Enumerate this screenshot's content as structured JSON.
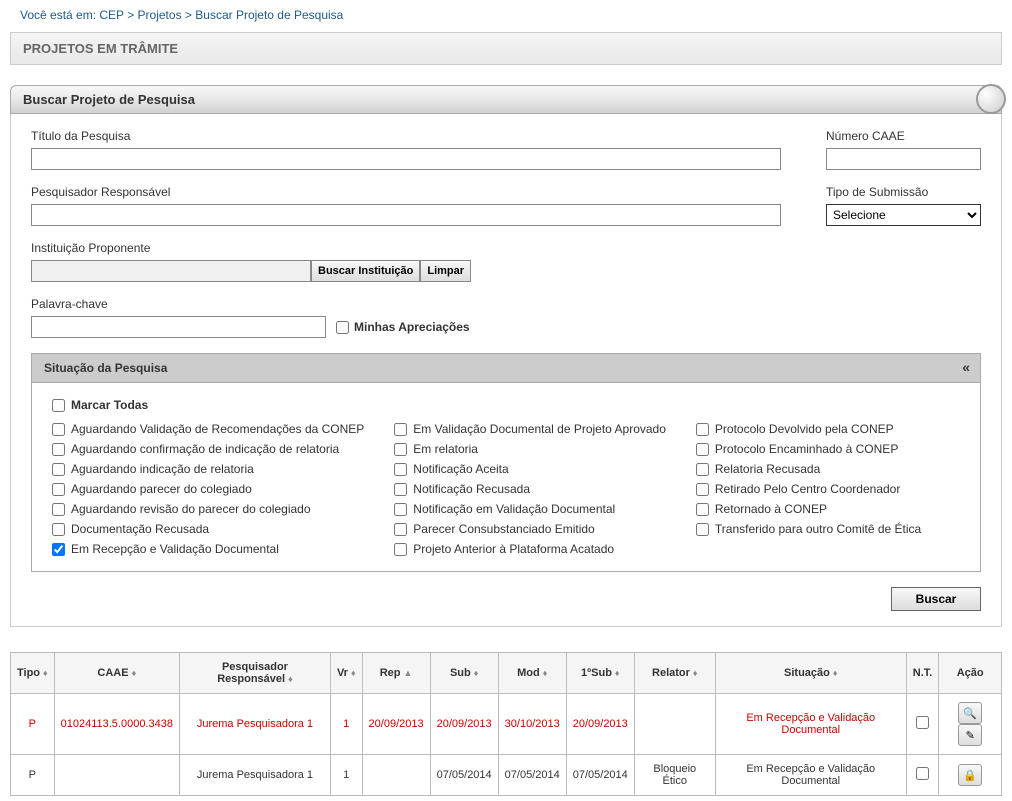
{
  "breadcrumb": {
    "prefix": "Você está em: ",
    "parts": [
      "CEP",
      "Projetos",
      "Buscar Projeto de Pesquisa"
    ]
  },
  "headers": {
    "section": "PROJETOS EM TRÂMITE",
    "search": "Buscar Projeto de Pesquisa",
    "situacao": "Situação da Pesquisa"
  },
  "labels": {
    "titulo": "Título da Pesquisa",
    "caae": "Número CAAE",
    "pesquisador": "Pesquisador Responsável",
    "tipo_sub": "Tipo de Submissão",
    "instituicao": "Instituição Proponente",
    "palavra": "Palavra-chave",
    "minhas": "Minhas Apreciações",
    "marcar_todas": "Marcar Todas"
  },
  "buttons": {
    "buscar_inst": "Buscar Instituição",
    "limpar": "Limpar",
    "buscar": "Buscar"
  },
  "select": {
    "tipo_sub_value": "Selecione"
  },
  "situacoes": {
    "col1": [
      {
        "label": "Aguardando Validação de Recomendações da CONEP",
        "checked": false
      },
      {
        "label": "Aguardando confirmação de indicação de relatoria",
        "checked": false
      },
      {
        "label": "Aguardando indicação de relatoria",
        "checked": false
      },
      {
        "label": "Aguardando parecer do colegiado",
        "checked": false
      },
      {
        "label": "Aguardando revisão do parecer do colegiado",
        "checked": false
      },
      {
        "label": "Documentação Recusada",
        "checked": false
      },
      {
        "label": "Em Recepção e Validação Documental",
        "checked": true
      }
    ],
    "col2": [
      {
        "label": "Em Validação Documental de Projeto Aprovado",
        "checked": false
      },
      {
        "label": "Em relatoria",
        "checked": false
      },
      {
        "label": "Notificação Aceita",
        "checked": false
      },
      {
        "label": "Notificação Recusada",
        "checked": false
      },
      {
        "label": "Notificação em Validação Documental",
        "checked": false
      },
      {
        "label": "Parecer Consubstanciado Emitido",
        "checked": false
      },
      {
        "label": "Projeto Anterior à Plataforma Acatado",
        "checked": false
      }
    ],
    "col3": [
      {
        "label": "Protocolo Devolvido pela CONEP",
        "checked": false
      },
      {
        "label": "Protocolo Encaminhado à CONEP",
        "checked": false
      },
      {
        "label": "Relatoria Recusada",
        "checked": false
      },
      {
        "label": "Retirado Pelo Centro Coordenador",
        "checked": false
      },
      {
        "label": "Retornado à CONEP",
        "checked": false
      },
      {
        "label": "Transferido para outro Comitê de Ética",
        "checked": false
      }
    ]
  },
  "table": {
    "headers": [
      "Tipo",
      "CAAE",
      "Pesquisador Responsável",
      "Vr",
      "Rep",
      "Sub",
      "Mod",
      "1ºSub",
      "Relator",
      "Situação",
      "N.T.",
      "Ação"
    ],
    "rows": [
      {
        "highlight": true,
        "tipo": "P",
        "caae": "01024113.5.0000.3438",
        "pesquisador": "Jurema Pesquisadora 1",
        "vr": "1",
        "rep": "20/09/2013",
        "sub": "20/09/2013",
        "mod": "30/10/2013",
        "sub1": "20/09/2013",
        "relator": "",
        "situacao": "Em Recepção e Validação Documental",
        "nt_checked": false,
        "actions": [
          "view",
          "edit"
        ]
      },
      {
        "highlight": false,
        "tipo": "P",
        "caae": "",
        "pesquisador": "Jurema Pesquisadora 1",
        "vr": "1",
        "rep": "",
        "sub": "07/05/2014",
        "mod": "07/05/2014",
        "sub1": "07/05/2014",
        "relator": "Bloqueio Ético",
        "situacao": "Em Recepção e Validação Documental",
        "nt_checked": false,
        "actions": [
          "lock"
        ]
      }
    ]
  }
}
